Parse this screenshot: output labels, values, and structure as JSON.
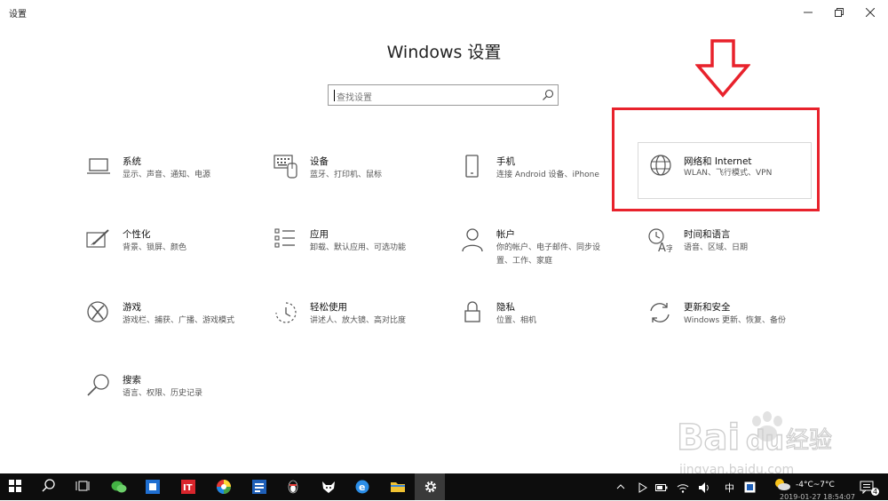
{
  "window": {
    "title": "设置"
  },
  "header": {
    "title": "Windows 设置"
  },
  "search": {
    "placeholder": "查找设置"
  },
  "tiles": [
    {
      "title": "系统",
      "desc": "显示、声音、通知、电源",
      "icon": "laptop-icon"
    },
    {
      "title": "设备",
      "desc": "蓝牙、打印机、鼠标",
      "icon": "keyboard-icon"
    },
    {
      "title": "手机",
      "desc": "连接 Android 设备、iPhone",
      "icon": "phone-icon"
    },
    {
      "title": "网络和 Internet",
      "desc": "WLAN、飞行模式、VPN",
      "icon": "globe-icon"
    },
    {
      "title": "个性化",
      "desc": "背景、锁屏、颜色",
      "icon": "paint-icon"
    },
    {
      "title": "应用",
      "desc": "卸载、默认应用、可选功能",
      "icon": "apps-list-icon"
    },
    {
      "title": "帐户",
      "desc": "你的帐户、电子邮件、同步设置、工作、家庭",
      "icon": "person-icon"
    },
    {
      "title": "时间和语言",
      "desc": "语音、区域、日期",
      "icon": "time-language-icon"
    },
    {
      "title": "游戏",
      "desc": "游戏栏、捕获、广播、游戏模式",
      "icon": "xbox-icon"
    },
    {
      "title": "轻松使用",
      "desc": "讲述人、放大镜、高对比度",
      "icon": "ease-of-access-icon"
    },
    {
      "title": "隐私",
      "desc": "位置、相机",
      "icon": "lock-icon"
    },
    {
      "title": "更新和安全",
      "desc": "Windows 更新、恢复、备份",
      "icon": "update-icon"
    },
    {
      "title": "搜索",
      "desc": "语言、权限、历史记录",
      "icon": "search-icon"
    }
  ],
  "watermark": {
    "brand": "Bai",
    "brand2": "du",
    "brand_cn": "经验",
    "url": "jingyan.baidu.com"
  },
  "tray": {
    "temp": "-4°C~7°C",
    "datetime": "2019-01-27 18:54:07",
    "ime": "中",
    "notifications": "4"
  },
  "colors": {
    "highlight_box": "#e8222c",
    "taskbar": "#0d0d0d"
  }
}
